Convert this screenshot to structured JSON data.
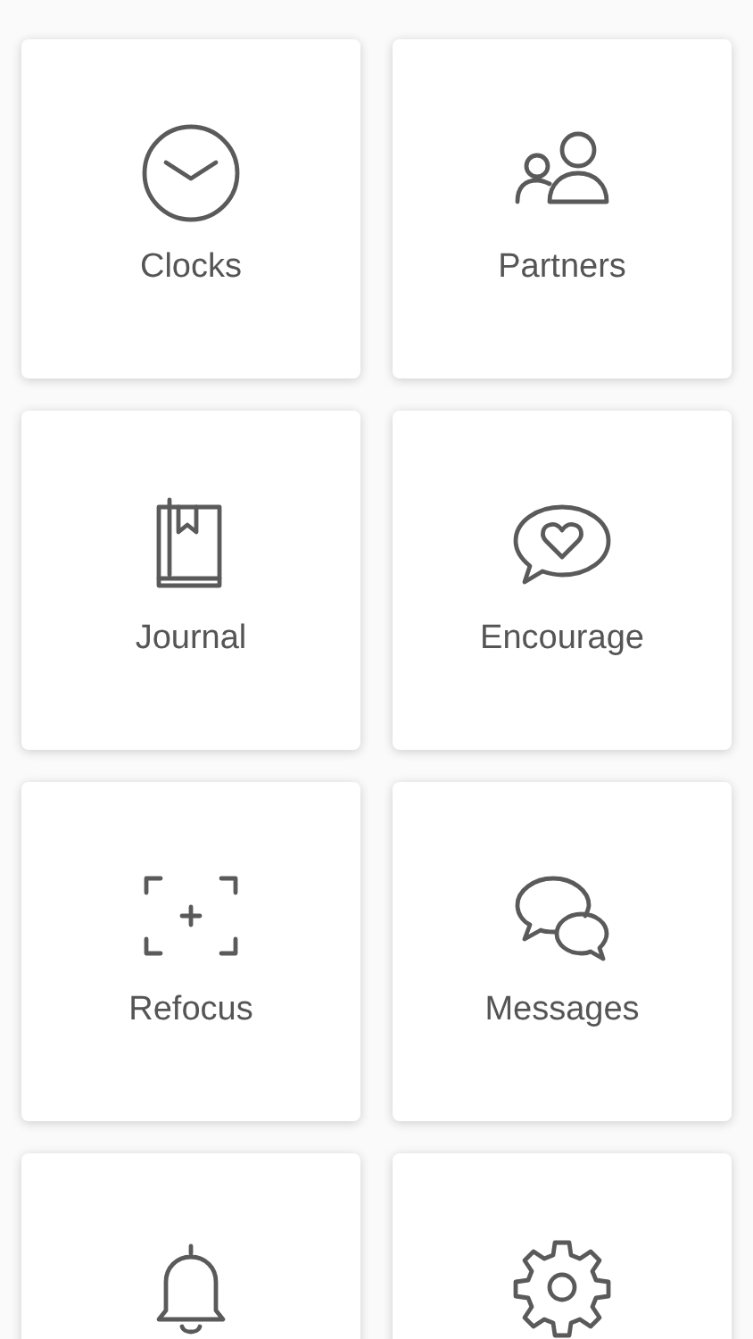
{
  "tiles": [
    {
      "kind": "tile",
      "label": "Clocks"
    },
    {
      "kind": "tile",
      "label": "Partners"
    },
    {
      "kind": "tile",
      "label": "Journal"
    },
    {
      "kind": "tile",
      "label": "Encourage"
    },
    {
      "kind": "tile",
      "label": "Refocus"
    },
    {
      "kind": "tile",
      "label": "Messages"
    },
    {
      "kind": "tile"
    },
    {
      "kind": "tile"
    }
  ]
}
